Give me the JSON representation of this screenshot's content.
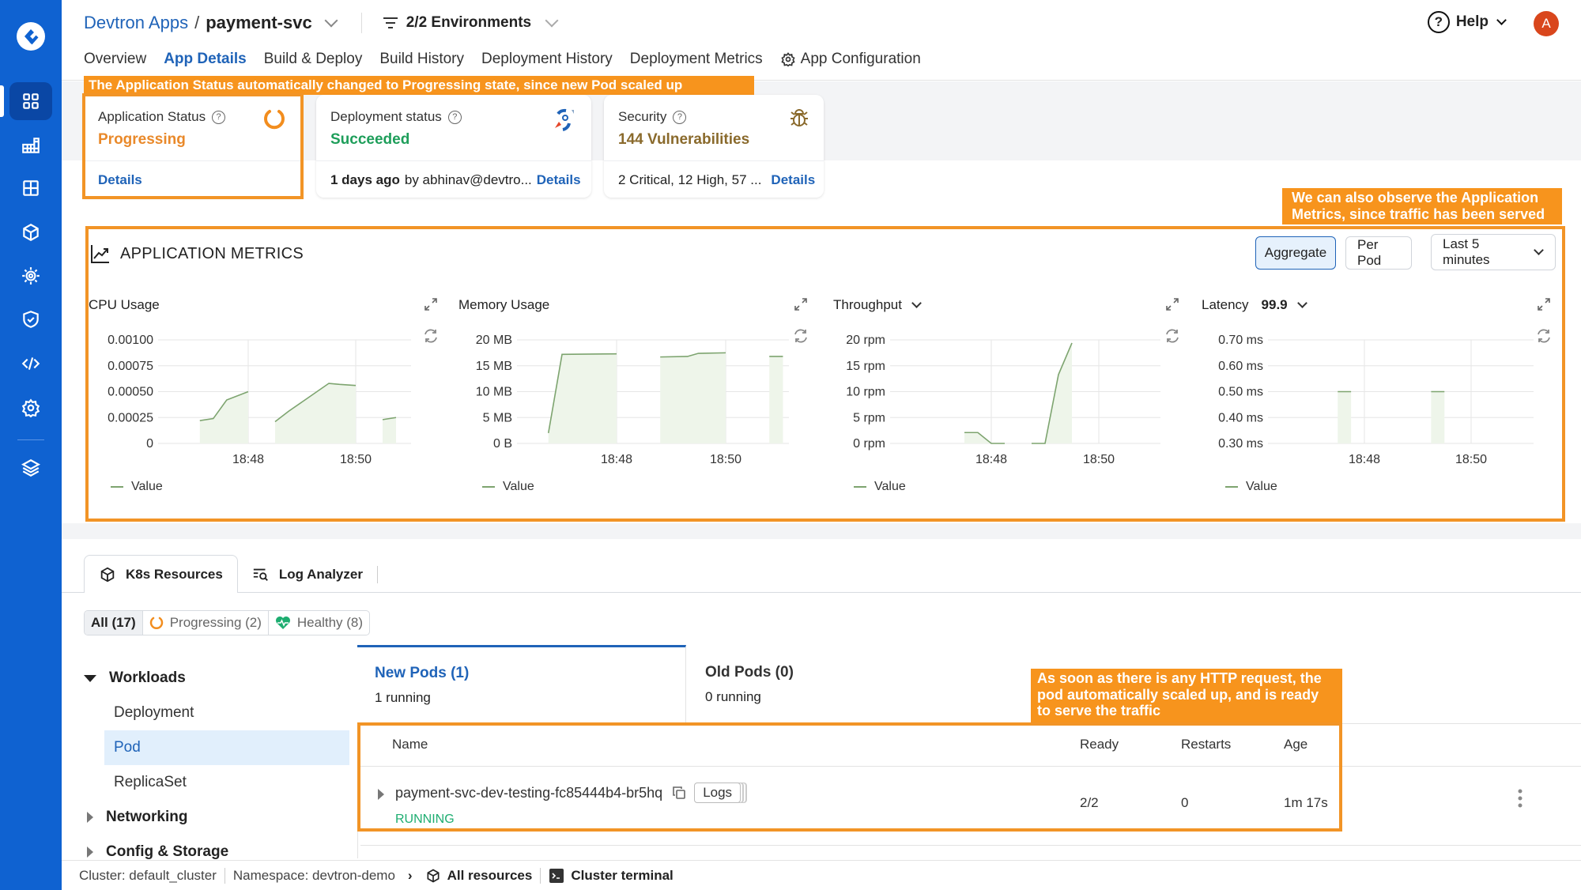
{
  "sidebar": {
    "logo": "devtron-logo-icon",
    "items": [
      {
        "name": "applications",
        "icon": "grid-icon",
        "active": true
      },
      {
        "name": "app-groups",
        "icon": "building-grid-icon"
      },
      {
        "name": "resource-browser",
        "icon": "table-grid-icon"
      },
      {
        "name": "charts",
        "icon": "cube-icon"
      },
      {
        "name": "security-scan",
        "icon": "sun-bug-icon"
      },
      {
        "name": "security-policies",
        "icon": "shield-check-icon"
      },
      {
        "name": "bulk-edit",
        "icon": "code-icon"
      },
      {
        "name": "global-config",
        "icon": "gear-icon"
      },
      {
        "name": "stack-manager",
        "icon": "layers-icon"
      }
    ]
  },
  "header": {
    "breadcrumb_root": "Devtron Apps",
    "breadcrumb_sep": "/",
    "app_name": "payment-svc",
    "environments": "2/2 Environments",
    "help": "Help",
    "avatar_initial": "A",
    "tabs": [
      {
        "label": "Overview"
      },
      {
        "label": "App Details",
        "active": true
      },
      {
        "label": "Build & Deploy"
      },
      {
        "label": "Build History"
      },
      {
        "label": "Deployment History"
      },
      {
        "label": "Deployment Metrics"
      },
      {
        "label": "App Configuration"
      }
    ]
  },
  "annotations": {
    "status": "The Application Status automatically changed to Progressing state, since new Pod scaled up",
    "metrics_line1": "We can also observe the Application",
    "metrics_line2": "Metrics, since traffic has been served",
    "pod_line1": "As soon as there is any HTTP request, the",
    "pod_line2": "pod automatically scaled up, and is ready",
    "pod_line3": "to serve the traffic"
  },
  "cards": {
    "app_status": {
      "label": "Application Status",
      "value": "Progressing",
      "link": "Details",
      "color": "#e9892a"
    },
    "deploy_status": {
      "label": "Deployment status",
      "value": "Succeeded",
      "time": "1 days ago",
      "by": "by abhinav@devtro...",
      "link": "Details",
      "color": "#1e9e5a"
    },
    "security": {
      "label": "Security",
      "value": "144 Vulnerabilities",
      "summary": "2 Critical, 12 High, 57 ...",
      "link": "Details",
      "color": "#8a6a2c"
    }
  },
  "metrics": {
    "title": "APPLICATION METRICS",
    "aggregate": "Aggregate",
    "per_pod": "Per Pod",
    "range": "Last 5 minutes",
    "legend": "Value"
  },
  "chart_data": [
    {
      "type": "area",
      "title": "CPU Usage",
      "x_ticks": [
        "18:48",
        "18:50"
      ],
      "y_ticks": [
        "0",
        "0.00025",
        "0.00050",
        "0.00075",
        "0.00100"
      ],
      "ylim": [
        0,
        0.001
      ],
      "xlim": [
        -3.2,
        2.3
      ],
      "series": [
        {
          "name": "Value",
          "segments": [
            [
              [
                -0.9,
                0.00022
              ],
              [
                -0.65,
                0.00024
              ],
              [
                -0.4,
                0.00042
              ],
              [
                0,
                0.0005
              ]
            ],
            [
              [
                0.5,
                0.00021
              ],
              [
                0.75,
                0.00031
              ],
              [
                1.5,
                0.00058
              ],
              [
                1.7,
                0.00057
              ],
              [
                2.0,
                0.00056
              ]
            ],
            [
              [
                2.5,
                0.00023
              ],
              [
                2.75,
                0.00025
              ]
            ]
          ]
        }
      ]
    },
    {
      "type": "area",
      "title": "Memory Usage",
      "x_ticks": [
        "18:48",
        "18:50"
      ],
      "y_ticks": [
        "0 B",
        "5 MB",
        "10 MB",
        "15 MB",
        "20 MB"
      ],
      "ylim": [
        0,
        20
      ],
      "series": [
        {
          "name": "Value",
          "segments": [
            [
              [
                -1.25,
                2
              ],
              [
                -1.0,
                17.2
              ],
              [
                0,
                17.3
              ]
            ],
            [
              [
                0.8,
                16.7
              ],
              [
                1.3,
                16.8
              ],
              [
                1.5,
                17.4
              ],
              [
                2.0,
                17.5
              ]
            ],
            [
              [
                2.8,
                16.8
              ],
              [
                3.05,
                16.8
              ]
            ]
          ]
        }
      ]
    },
    {
      "type": "area",
      "title": "Throughput",
      "x_ticks": [
        "18:48",
        "18:50"
      ],
      "y_ticks": [
        "0 rpm",
        "5 rpm",
        "10 rpm",
        "15 rpm",
        "20 rpm"
      ],
      "ylim": [
        0,
        20
      ],
      "series": [
        {
          "name": "Value",
          "segments": [
            [
              [
                -0.5,
                2.1
              ],
              [
                -0.25,
                2.1
              ],
              [
                0,
                0
              ],
              [
                0.25,
                0
              ]
            ],
            [
              [
                0.75,
                0
              ],
              [
                1.0,
                0
              ],
              [
                1.25,
                13.3
              ],
              [
                1.5,
                19.4
              ]
            ]
          ]
        }
      ]
    },
    {
      "type": "area",
      "title": "Latency",
      "percentile": "99.9",
      "x_ticks": [
        "18:48",
        "18:50"
      ],
      "y_ticks": [
        "0.30 ms",
        "0.40 ms",
        "0.50 ms",
        "0.60 ms",
        "0.70 ms"
      ],
      "ylim": [
        0.3,
        0.7
      ],
      "series": [
        {
          "name": "Value",
          "segments": [
            [
              [
                -0.5,
                0.5
              ],
              [
                -0.25,
                0.5
              ]
            ],
            [
              [
                1.25,
                0.5
              ],
              [
                1.5,
                0.5
              ]
            ]
          ]
        }
      ]
    }
  ],
  "resources": {
    "tabs": [
      {
        "label": "K8s Resources",
        "active": true
      },
      {
        "label": "Log Analyzer"
      }
    ],
    "filters": [
      {
        "label": "All (17)",
        "active": true
      },
      {
        "label": "Progressing (2)"
      },
      {
        "label": "Healthy (8)"
      }
    ],
    "tree": {
      "workloads": "Workloads",
      "items": [
        "Deployment",
        "Pod",
        "ReplicaSet"
      ],
      "active_item": "Pod",
      "networking": "Networking",
      "config_storage": "Config & Storage"
    },
    "pod_tabs": [
      {
        "title": "New Pods (1)",
        "sub": "1 running",
        "active": true
      },
      {
        "title": "Old Pods (0)",
        "sub": "0 running"
      }
    ],
    "table": {
      "headers": {
        "name": "Name",
        "ready": "Ready",
        "restarts": "Restarts",
        "age": "Age"
      },
      "rows": [
        {
          "name": "payment-svc-dev-testing-fc85444b4-br5hq",
          "status": "RUNNING",
          "ready": "2/2",
          "restarts": "0",
          "age": "1m 17s",
          "logs": "Logs"
        }
      ]
    }
  },
  "footer": {
    "cluster": "Cluster: default_cluster",
    "namespace": "Namespace: devtron-demo",
    "all_resources": "All resources",
    "terminal": "Cluster terminal"
  }
}
